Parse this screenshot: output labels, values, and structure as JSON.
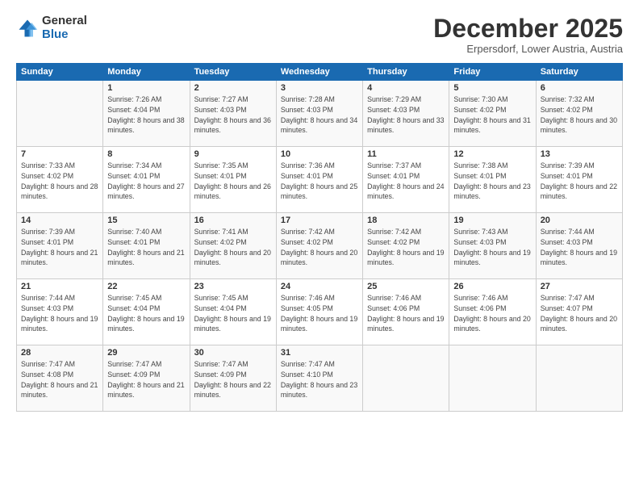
{
  "header": {
    "logo_general": "General",
    "logo_blue": "Blue",
    "month_title": "December 2025",
    "location": "Erpersdorf, Lower Austria, Austria"
  },
  "calendar": {
    "weekdays": [
      "Sunday",
      "Monday",
      "Tuesday",
      "Wednesday",
      "Thursday",
      "Friday",
      "Saturday"
    ],
    "weeks": [
      [
        {
          "day": "",
          "sunrise": "",
          "sunset": "",
          "daylight": ""
        },
        {
          "day": "1",
          "sunrise": "Sunrise: 7:26 AM",
          "sunset": "Sunset: 4:04 PM",
          "daylight": "Daylight: 8 hours and 38 minutes."
        },
        {
          "day": "2",
          "sunrise": "Sunrise: 7:27 AM",
          "sunset": "Sunset: 4:03 PM",
          "daylight": "Daylight: 8 hours and 36 minutes."
        },
        {
          "day": "3",
          "sunrise": "Sunrise: 7:28 AM",
          "sunset": "Sunset: 4:03 PM",
          "daylight": "Daylight: 8 hours and 34 minutes."
        },
        {
          "day": "4",
          "sunrise": "Sunrise: 7:29 AM",
          "sunset": "Sunset: 4:03 PM",
          "daylight": "Daylight: 8 hours and 33 minutes."
        },
        {
          "day": "5",
          "sunrise": "Sunrise: 7:30 AM",
          "sunset": "Sunset: 4:02 PM",
          "daylight": "Daylight: 8 hours and 31 minutes."
        },
        {
          "day": "6",
          "sunrise": "Sunrise: 7:32 AM",
          "sunset": "Sunset: 4:02 PM",
          "daylight": "Daylight: 8 hours and 30 minutes."
        }
      ],
      [
        {
          "day": "7",
          "sunrise": "Sunrise: 7:33 AM",
          "sunset": "Sunset: 4:02 PM",
          "daylight": "Daylight: 8 hours and 28 minutes."
        },
        {
          "day": "8",
          "sunrise": "Sunrise: 7:34 AM",
          "sunset": "Sunset: 4:01 PM",
          "daylight": "Daylight: 8 hours and 27 minutes."
        },
        {
          "day": "9",
          "sunrise": "Sunrise: 7:35 AM",
          "sunset": "Sunset: 4:01 PM",
          "daylight": "Daylight: 8 hours and 26 minutes."
        },
        {
          "day": "10",
          "sunrise": "Sunrise: 7:36 AM",
          "sunset": "Sunset: 4:01 PM",
          "daylight": "Daylight: 8 hours and 25 minutes."
        },
        {
          "day": "11",
          "sunrise": "Sunrise: 7:37 AM",
          "sunset": "Sunset: 4:01 PM",
          "daylight": "Daylight: 8 hours and 24 minutes."
        },
        {
          "day": "12",
          "sunrise": "Sunrise: 7:38 AM",
          "sunset": "Sunset: 4:01 PM",
          "daylight": "Daylight: 8 hours and 23 minutes."
        },
        {
          "day": "13",
          "sunrise": "Sunrise: 7:39 AM",
          "sunset": "Sunset: 4:01 PM",
          "daylight": "Daylight: 8 hours and 22 minutes."
        }
      ],
      [
        {
          "day": "14",
          "sunrise": "Sunrise: 7:39 AM",
          "sunset": "Sunset: 4:01 PM",
          "daylight": "Daylight: 8 hours and 21 minutes."
        },
        {
          "day": "15",
          "sunrise": "Sunrise: 7:40 AM",
          "sunset": "Sunset: 4:01 PM",
          "daylight": "Daylight: 8 hours and 21 minutes."
        },
        {
          "day": "16",
          "sunrise": "Sunrise: 7:41 AM",
          "sunset": "Sunset: 4:02 PM",
          "daylight": "Daylight: 8 hours and 20 minutes."
        },
        {
          "day": "17",
          "sunrise": "Sunrise: 7:42 AM",
          "sunset": "Sunset: 4:02 PM",
          "daylight": "Daylight: 8 hours and 20 minutes."
        },
        {
          "day": "18",
          "sunrise": "Sunrise: 7:42 AM",
          "sunset": "Sunset: 4:02 PM",
          "daylight": "Daylight: 8 hours and 19 minutes."
        },
        {
          "day": "19",
          "sunrise": "Sunrise: 7:43 AM",
          "sunset": "Sunset: 4:03 PM",
          "daylight": "Daylight: 8 hours and 19 minutes."
        },
        {
          "day": "20",
          "sunrise": "Sunrise: 7:44 AM",
          "sunset": "Sunset: 4:03 PM",
          "daylight": "Daylight: 8 hours and 19 minutes."
        }
      ],
      [
        {
          "day": "21",
          "sunrise": "Sunrise: 7:44 AM",
          "sunset": "Sunset: 4:03 PM",
          "daylight": "Daylight: 8 hours and 19 minutes."
        },
        {
          "day": "22",
          "sunrise": "Sunrise: 7:45 AM",
          "sunset": "Sunset: 4:04 PM",
          "daylight": "Daylight: 8 hours and 19 minutes."
        },
        {
          "day": "23",
          "sunrise": "Sunrise: 7:45 AM",
          "sunset": "Sunset: 4:04 PM",
          "daylight": "Daylight: 8 hours and 19 minutes."
        },
        {
          "day": "24",
          "sunrise": "Sunrise: 7:46 AM",
          "sunset": "Sunset: 4:05 PM",
          "daylight": "Daylight: 8 hours and 19 minutes."
        },
        {
          "day": "25",
          "sunrise": "Sunrise: 7:46 AM",
          "sunset": "Sunset: 4:06 PM",
          "daylight": "Daylight: 8 hours and 19 minutes."
        },
        {
          "day": "26",
          "sunrise": "Sunrise: 7:46 AM",
          "sunset": "Sunset: 4:06 PM",
          "daylight": "Daylight: 8 hours and 20 minutes."
        },
        {
          "day": "27",
          "sunrise": "Sunrise: 7:47 AM",
          "sunset": "Sunset: 4:07 PM",
          "daylight": "Daylight: 8 hours and 20 minutes."
        }
      ],
      [
        {
          "day": "28",
          "sunrise": "Sunrise: 7:47 AM",
          "sunset": "Sunset: 4:08 PM",
          "daylight": "Daylight: 8 hours and 21 minutes."
        },
        {
          "day": "29",
          "sunrise": "Sunrise: 7:47 AM",
          "sunset": "Sunset: 4:09 PM",
          "daylight": "Daylight: 8 hours and 21 minutes."
        },
        {
          "day": "30",
          "sunrise": "Sunrise: 7:47 AM",
          "sunset": "Sunset: 4:09 PM",
          "daylight": "Daylight: 8 hours and 22 minutes."
        },
        {
          "day": "31",
          "sunrise": "Sunrise: 7:47 AM",
          "sunset": "Sunset: 4:10 PM",
          "daylight": "Daylight: 8 hours and 23 minutes."
        },
        {
          "day": "",
          "sunrise": "",
          "sunset": "",
          "daylight": ""
        },
        {
          "day": "",
          "sunrise": "",
          "sunset": "",
          "daylight": ""
        },
        {
          "day": "",
          "sunrise": "",
          "sunset": "",
          "daylight": ""
        }
      ]
    ]
  }
}
